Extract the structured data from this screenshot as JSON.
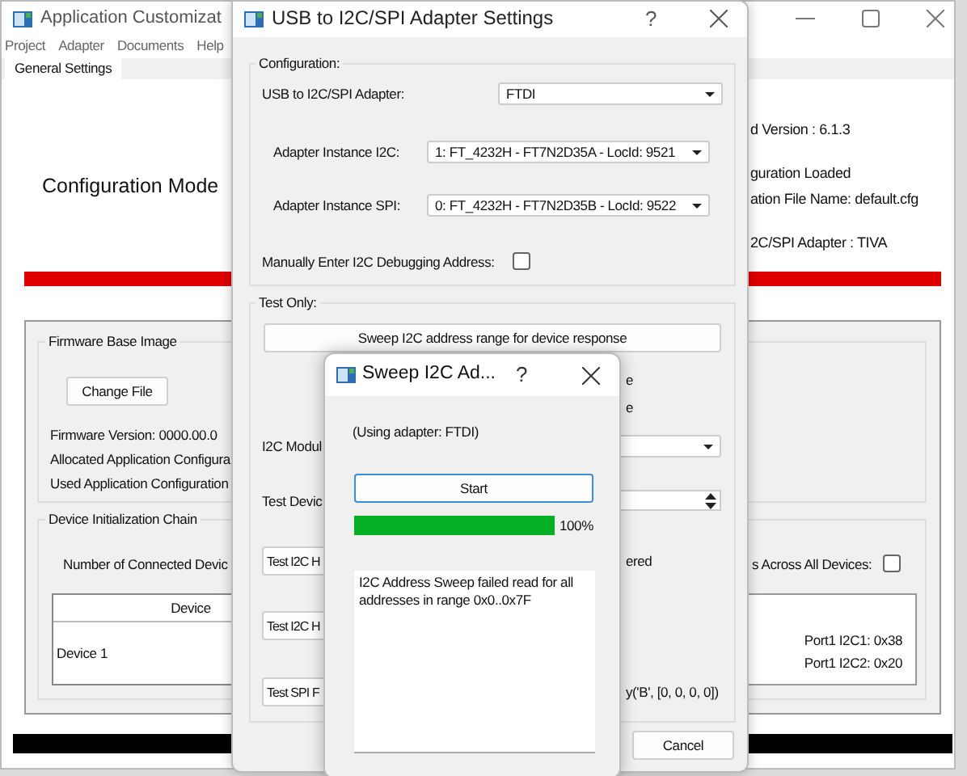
{
  "main_window": {
    "title": "Application Customizat",
    "menu": [
      "Project",
      "Adapter",
      "Documents",
      "Help"
    ],
    "tabs": [
      {
        "label": "General Settings",
        "selected": true
      }
    ],
    "mode_title": "Configuration Mode",
    "status_lines": [
      "d Version : 6.1.3",
      "guration Loaded",
      "ation File Name: default.cfg",
      "2C/SPI Adapter : TIVA"
    ],
    "firmware_group": {
      "title": "Firmware Base Image",
      "button": "Change File",
      "lines": [
        "Firmware Version:   0000.00.0",
        "Allocated Application Configura",
        "Used Application Configuration"
      ]
    },
    "device_chain": {
      "title": "Device Initialization Chain",
      "count_label": "Number of Connected Devic",
      "all_devices_label": "s Across All Devices:",
      "all_devices_checked": false,
      "table": {
        "columns": [
          "Device"
        ],
        "rows": [
          [
            "Device 1"
          ]
        ]
      },
      "ports": [
        "Port1 I2C1: 0x38",
        "Port1 I2C2: 0x20"
      ]
    }
  },
  "settings_dialog": {
    "title": "USB to I2C/SPI Adapter Settings",
    "help": "?",
    "configuration": {
      "title": "Configuration:",
      "adapter_label": "USB to I2C/SPI Adapter:",
      "adapter": "FTDI",
      "i2c_label": "Adapter Instance I2C:",
      "i2c": "1: FT_4232H - FT7N2D35A - LocId: 9521",
      "spi_label": "Adapter Instance SPI:",
      "spi": "0: FT_4232H - FT7N2D35B - LocId: 9522",
      "manual_label": "Manually Enter I2C Debugging Address:",
      "manual_checked": false
    },
    "test_only": {
      "title": "Test Only:",
      "sweep_button": "Sweep I2C address range for device response",
      "fragments": [
        "e",
        "e"
      ],
      "module_label": "I2C Modul",
      "device_label": "Test Devic",
      "buttons": [
        {
          "label": "Test I2C H",
          "note": "ered"
        },
        {
          "label": "Test I2C H"
        },
        {
          "label": "Test SPI F",
          "note": "y('B', [0, 0, 0, 0])"
        }
      ]
    },
    "cancel": "Cancel"
  },
  "sweep_dialog": {
    "title": "Sweep I2C Ad...",
    "help": "?",
    "adapter_note": "(Using adapter: FTDI)",
    "start": "Start",
    "progress": {
      "level": 1.0,
      "reading": "100%"
    },
    "log": "I2C Address Sweep failed read for all addresses in range 0x0..0x7F"
  }
}
